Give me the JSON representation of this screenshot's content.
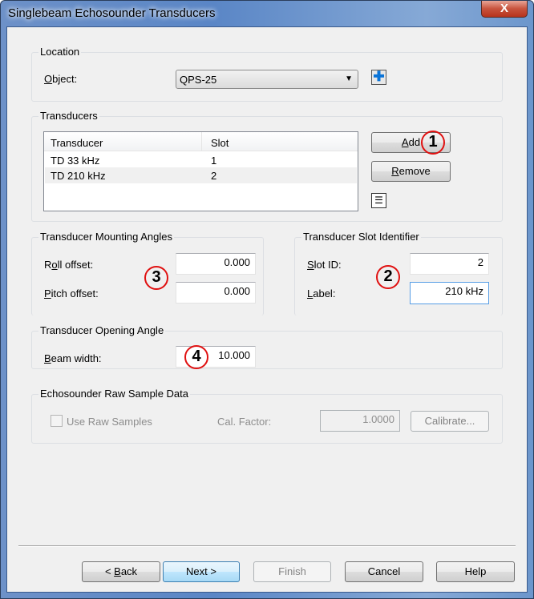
{
  "window": {
    "title": "Singlebeam Echosounder Transducers",
    "close_label": "X"
  },
  "location": {
    "title": "Location",
    "object_label": "Object:",
    "object_value": "QPS-25"
  },
  "transducers": {
    "title": "Transducers",
    "columns": [
      "Transducer",
      "Slot"
    ],
    "rows": [
      {
        "name": "TD 33 kHz",
        "slot": "1"
      },
      {
        "name": "TD 210 kHz",
        "slot": "2"
      }
    ],
    "add_label": "Add",
    "remove_label": "Remove"
  },
  "mounting": {
    "title": "Transducer Mounting Angles",
    "roll_label": "Roll offset:",
    "roll_value": "0.000",
    "pitch_label": "Pitch offset:",
    "pitch_value": "0.000"
  },
  "slot": {
    "title": "Transducer Slot Identifier",
    "slot_id_label": "Slot ID:",
    "slot_id_value": "2",
    "label_label": "Label:",
    "label_value": "210 kHz"
  },
  "opening": {
    "title": "Transducer Opening Angle",
    "beam_label": "Beam width:",
    "beam_value": "10.000"
  },
  "raw": {
    "title": "Echosounder Raw Sample Data",
    "use_raw_label": "Use Raw Samples",
    "use_raw_checked": false,
    "cal_label": "Cal. Factor:",
    "cal_value": "1.0000",
    "calibrate_label": "Calibrate..."
  },
  "footer": {
    "back": "< Back",
    "next": "Next >",
    "finish": "Finish",
    "cancel": "Cancel",
    "help": "Help"
  },
  "annotations": [
    "1",
    "2",
    "3",
    "4"
  ]
}
